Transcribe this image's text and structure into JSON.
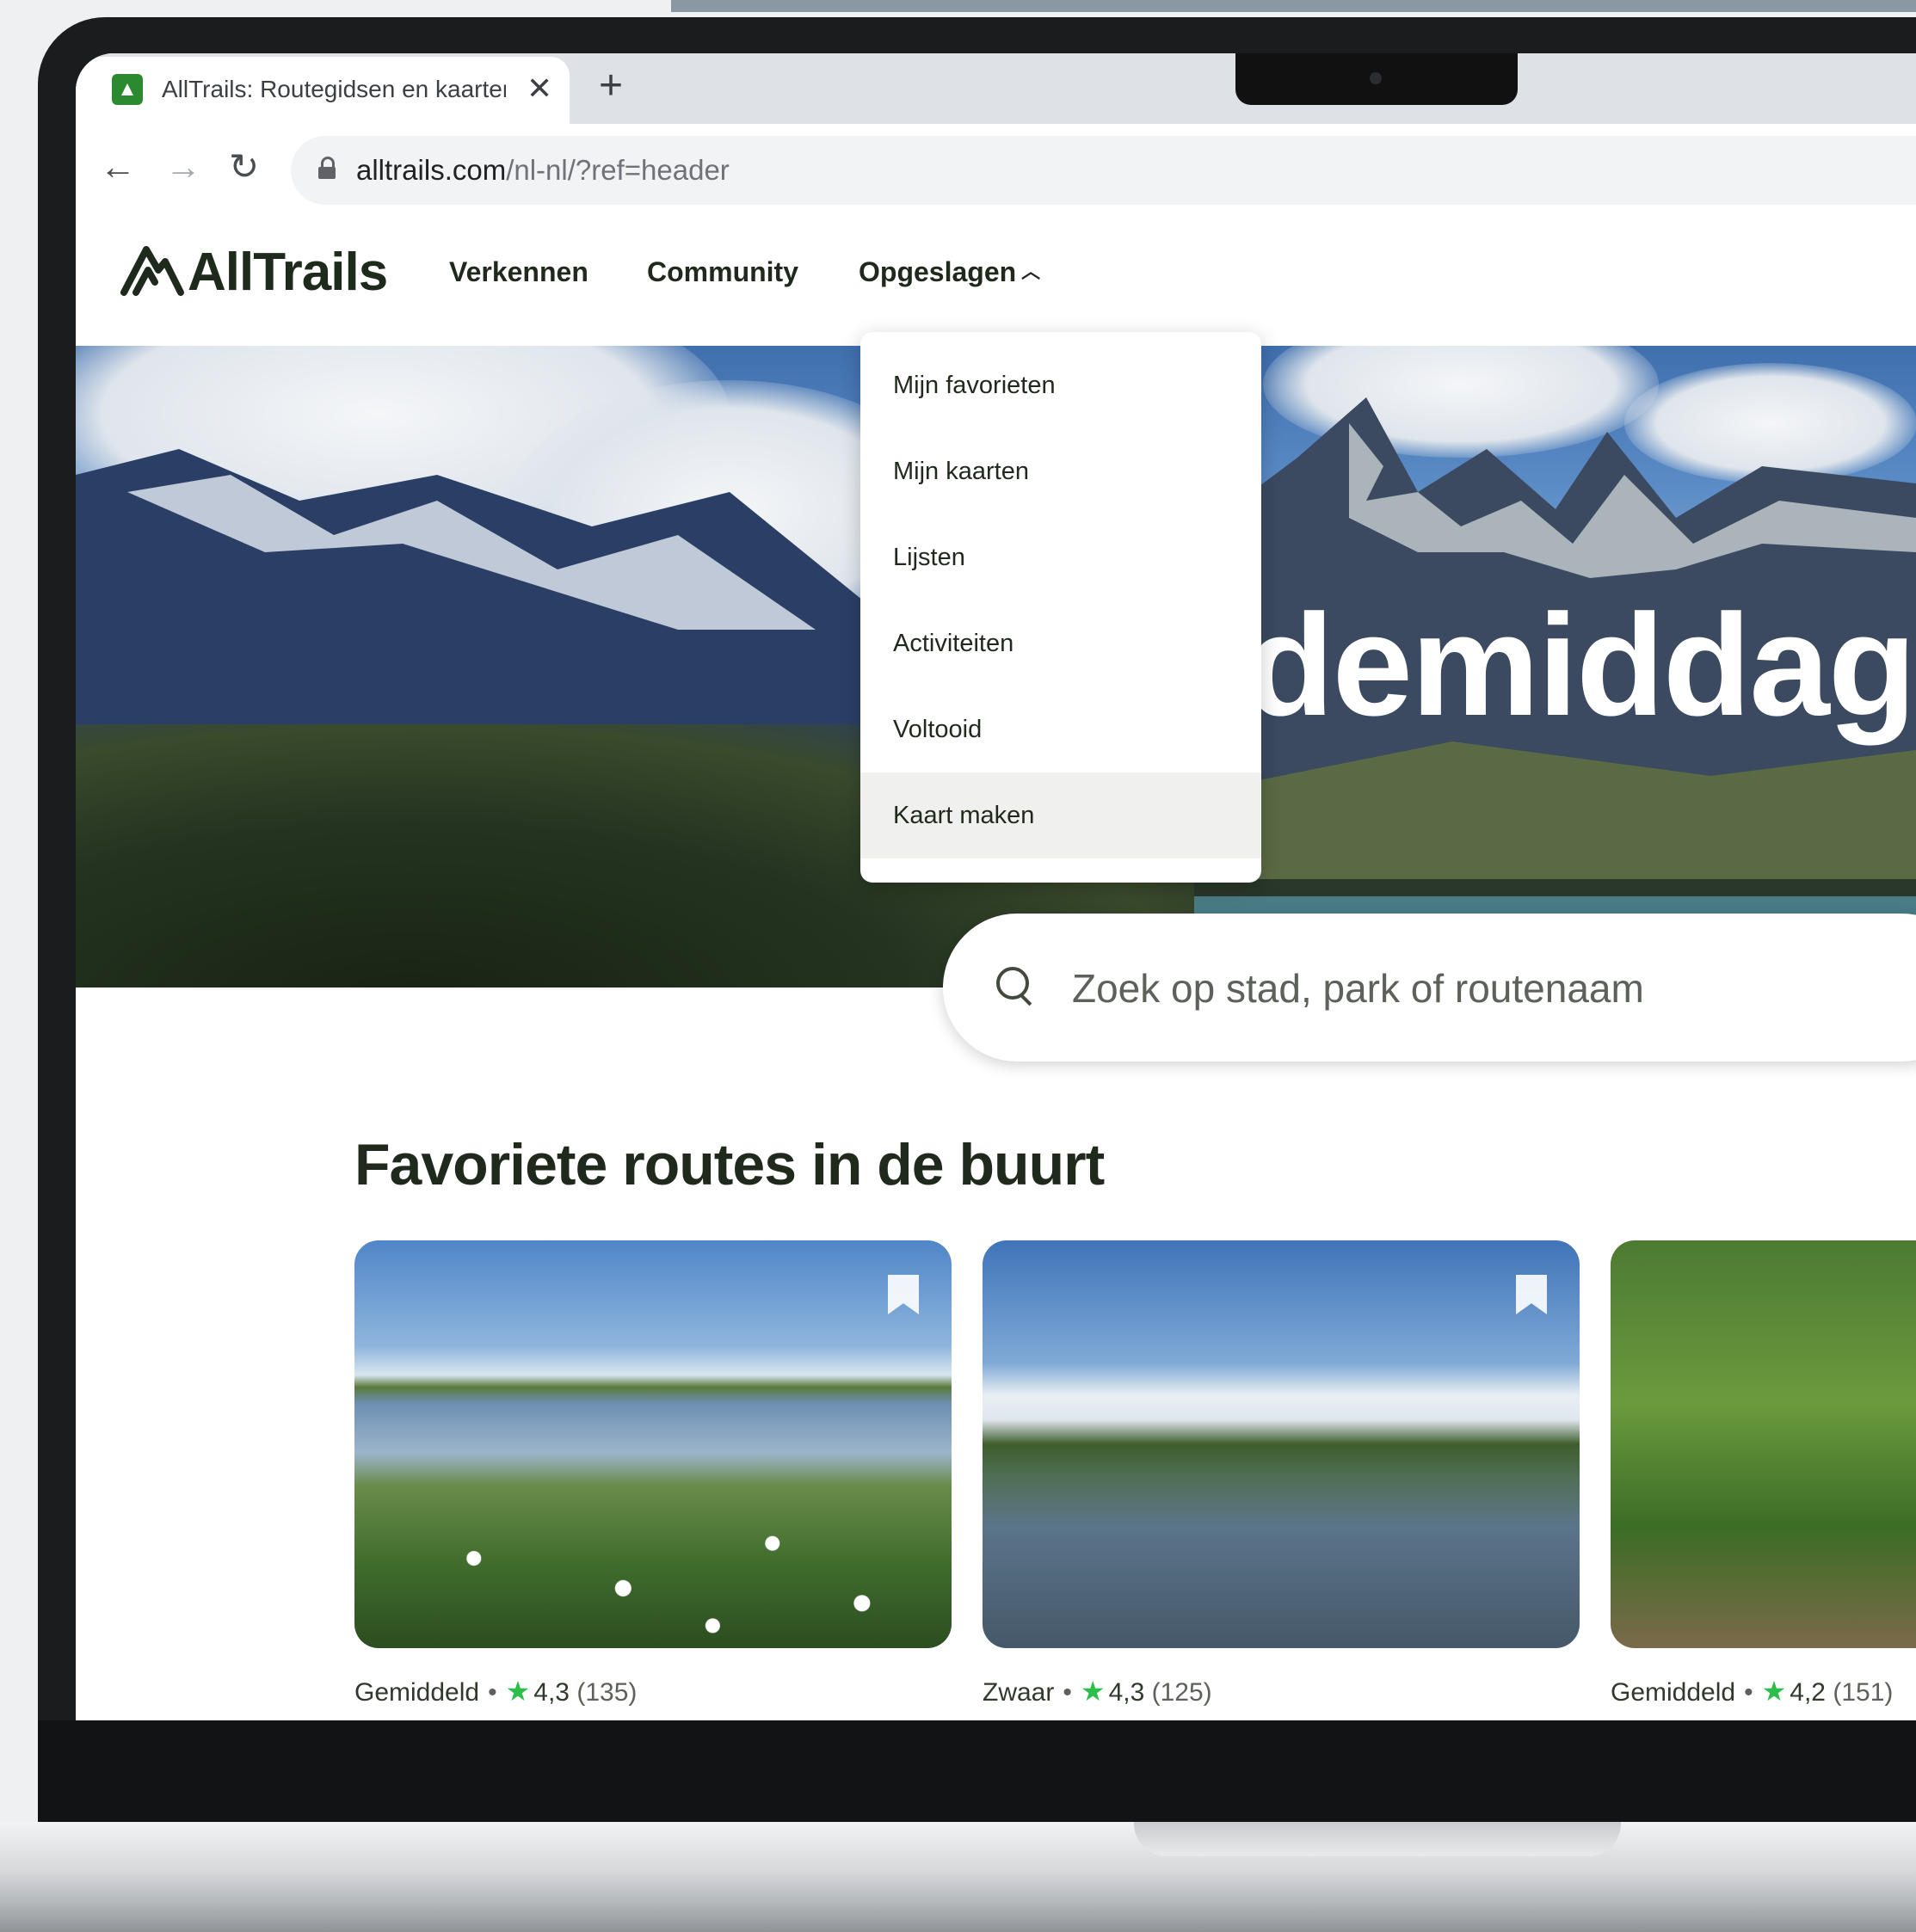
{
  "browser": {
    "tab_title": "AllTrails: Routegidsen en kaarten",
    "tab_close": "✕",
    "new_tab": "+",
    "url_main": "alltrails.com",
    "url_path": "/nl-nl/?ref=header",
    "back_icon": "←",
    "forward_icon": "→",
    "reload_icon": "↻"
  },
  "header": {
    "logo": "AllTrails",
    "nav": {
      "verkennen": "Verkennen",
      "community": "Community",
      "opgeslagen": "Opgeslagen"
    }
  },
  "dropdown": {
    "items": [
      "Mijn favorieten",
      "Mijn kaarten",
      "Lijsten",
      "Activiteiten",
      "Voltooid",
      "Kaart maken"
    ],
    "hovered_index": 5
  },
  "hero": {
    "title": "demiddag"
  },
  "search": {
    "placeholder": "Zoek op stad, park of routenaam"
  },
  "section": {
    "title": "Favoriete routes in de buurt"
  },
  "cards": [
    {
      "difficulty": "Gemiddeld",
      "rating": "4,3",
      "reviews": "(135)"
    },
    {
      "difficulty": "Zwaar",
      "rating": "4,3",
      "reviews": "(125)"
    },
    {
      "difficulty": "Gemiddeld",
      "rating": "4,2",
      "reviews": "(151)"
    }
  ],
  "colors": {
    "brand_dark": "#1f2a1d",
    "star_green": "#2bbf4a",
    "favicon_green": "#2b8a2f"
  }
}
